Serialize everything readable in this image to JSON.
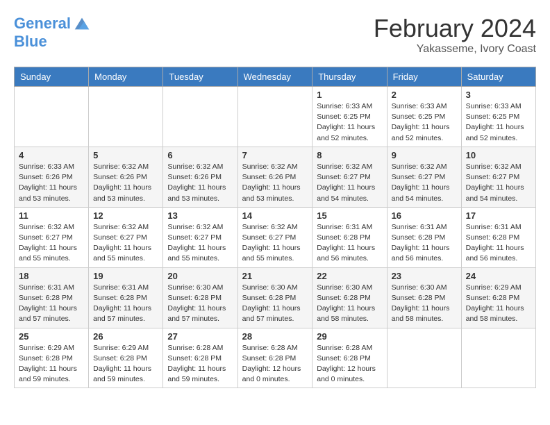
{
  "logo": {
    "line1": "General",
    "line2": "Blue"
  },
  "title": "February 2024",
  "subtitle": "Yakasseme, Ivory Coast",
  "weekdays": [
    "Sunday",
    "Monday",
    "Tuesday",
    "Wednesday",
    "Thursday",
    "Friday",
    "Saturday"
  ],
  "weeks": [
    [
      {
        "day": "",
        "info": ""
      },
      {
        "day": "",
        "info": ""
      },
      {
        "day": "",
        "info": ""
      },
      {
        "day": "",
        "info": ""
      },
      {
        "day": "1",
        "info": "Sunrise: 6:33 AM\nSunset: 6:25 PM\nDaylight: 11 hours\nand 52 minutes."
      },
      {
        "day": "2",
        "info": "Sunrise: 6:33 AM\nSunset: 6:25 PM\nDaylight: 11 hours\nand 52 minutes."
      },
      {
        "day": "3",
        "info": "Sunrise: 6:33 AM\nSunset: 6:25 PM\nDaylight: 11 hours\nand 52 minutes."
      }
    ],
    [
      {
        "day": "4",
        "info": "Sunrise: 6:33 AM\nSunset: 6:26 PM\nDaylight: 11 hours\nand 53 minutes."
      },
      {
        "day": "5",
        "info": "Sunrise: 6:32 AM\nSunset: 6:26 PM\nDaylight: 11 hours\nand 53 minutes."
      },
      {
        "day": "6",
        "info": "Sunrise: 6:32 AM\nSunset: 6:26 PM\nDaylight: 11 hours\nand 53 minutes."
      },
      {
        "day": "7",
        "info": "Sunrise: 6:32 AM\nSunset: 6:26 PM\nDaylight: 11 hours\nand 53 minutes."
      },
      {
        "day": "8",
        "info": "Sunrise: 6:32 AM\nSunset: 6:27 PM\nDaylight: 11 hours\nand 54 minutes."
      },
      {
        "day": "9",
        "info": "Sunrise: 6:32 AM\nSunset: 6:27 PM\nDaylight: 11 hours\nand 54 minutes."
      },
      {
        "day": "10",
        "info": "Sunrise: 6:32 AM\nSunset: 6:27 PM\nDaylight: 11 hours\nand 54 minutes."
      }
    ],
    [
      {
        "day": "11",
        "info": "Sunrise: 6:32 AM\nSunset: 6:27 PM\nDaylight: 11 hours\nand 55 minutes."
      },
      {
        "day": "12",
        "info": "Sunrise: 6:32 AM\nSunset: 6:27 PM\nDaylight: 11 hours\nand 55 minutes."
      },
      {
        "day": "13",
        "info": "Sunrise: 6:32 AM\nSunset: 6:27 PM\nDaylight: 11 hours\nand 55 minutes."
      },
      {
        "day": "14",
        "info": "Sunrise: 6:32 AM\nSunset: 6:27 PM\nDaylight: 11 hours\nand 55 minutes."
      },
      {
        "day": "15",
        "info": "Sunrise: 6:31 AM\nSunset: 6:28 PM\nDaylight: 11 hours\nand 56 minutes."
      },
      {
        "day": "16",
        "info": "Sunrise: 6:31 AM\nSunset: 6:28 PM\nDaylight: 11 hours\nand 56 minutes."
      },
      {
        "day": "17",
        "info": "Sunrise: 6:31 AM\nSunset: 6:28 PM\nDaylight: 11 hours\nand 56 minutes."
      }
    ],
    [
      {
        "day": "18",
        "info": "Sunrise: 6:31 AM\nSunset: 6:28 PM\nDaylight: 11 hours\nand 57 minutes."
      },
      {
        "day": "19",
        "info": "Sunrise: 6:31 AM\nSunset: 6:28 PM\nDaylight: 11 hours\nand 57 minutes."
      },
      {
        "day": "20",
        "info": "Sunrise: 6:30 AM\nSunset: 6:28 PM\nDaylight: 11 hours\nand 57 minutes."
      },
      {
        "day": "21",
        "info": "Sunrise: 6:30 AM\nSunset: 6:28 PM\nDaylight: 11 hours\nand 57 minutes."
      },
      {
        "day": "22",
        "info": "Sunrise: 6:30 AM\nSunset: 6:28 PM\nDaylight: 11 hours\nand 58 minutes."
      },
      {
        "day": "23",
        "info": "Sunrise: 6:30 AM\nSunset: 6:28 PM\nDaylight: 11 hours\nand 58 minutes."
      },
      {
        "day": "24",
        "info": "Sunrise: 6:29 AM\nSunset: 6:28 PM\nDaylight: 11 hours\nand 58 minutes."
      }
    ],
    [
      {
        "day": "25",
        "info": "Sunrise: 6:29 AM\nSunset: 6:28 PM\nDaylight: 11 hours\nand 59 minutes."
      },
      {
        "day": "26",
        "info": "Sunrise: 6:29 AM\nSunset: 6:28 PM\nDaylight: 11 hours\nand 59 minutes."
      },
      {
        "day": "27",
        "info": "Sunrise: 6:28 AM\nSunset: 6:28 PM\nDaylight: 11 hours\nand 59 minutes."
      },
      {
        "day": "28",
        "info": "Sunrise: 6:28 AM\nSunset: 6:28 PM\nDaylight: 12 hours\nand 0 minutes."
      },
      {
        "day": "29",
        "info": "Sunrise: 6:28 AM\nSunset: 6:28 PM\nDaylight: 12 hours\nand 0 minutes."
      },
      {
        "day": "",
        "info": ""
      },
      {
        "day": "",
        "info": ""
      }
    ]
  ]
}
